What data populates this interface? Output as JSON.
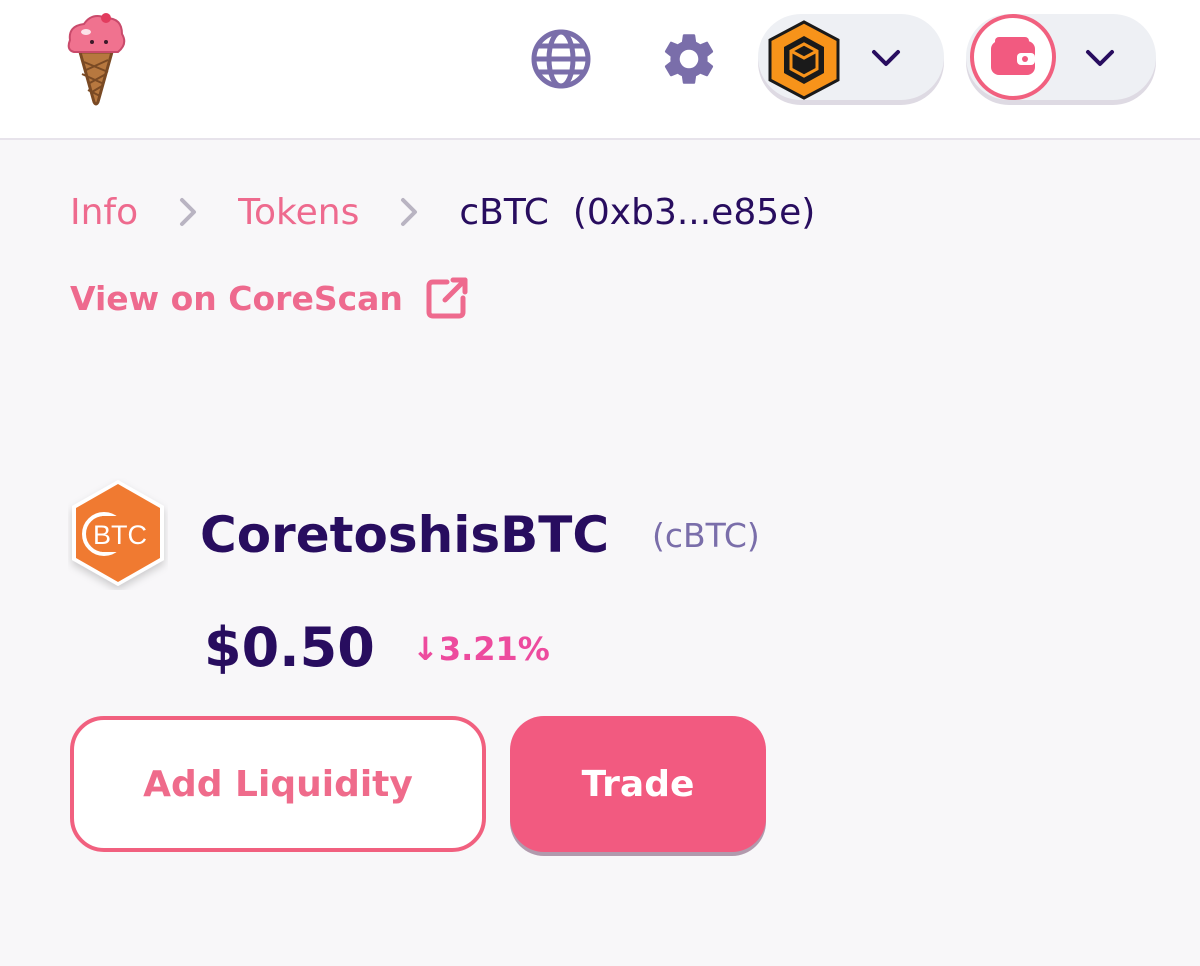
{
  "header": {
    "logo_icon": "ice-cream-icon",
    "language_icon": "globe-icon",
    "settings_icon": "gear-icon",
    "network_icon": "core-network-icon",
    "wallet_icon": "wallet-icon"
  },
  "breadcrumb": {
    "items": [
      {
        "label": "Info"
      },
      {
        "label": "Tokens"
      }
    ],
    "current": "cBTC",
    "address": "(0xb3...e85e)"
  },
  "explorer_link": {
    "label": "View on CoreScan"
  },
  "token": {
    "logo_text": "BTC",
    "name": "CoretoshisBTC",
    "symbol": "(cBTC)",
    "price": "$0.50",
    "change": "↓3.21%"
  },
  "actions": {
    "add_liquidity": "Add Liquidity",
    "trade": "Trade"
  },
  "colors": {
    "accent": "#f25a80",
    "text_dark": "#280d5f",
    "secondary": "#7a6eaa",
    "negative": "#ed4b9e",
    "network_orange": "#f7931a"
  }
}
